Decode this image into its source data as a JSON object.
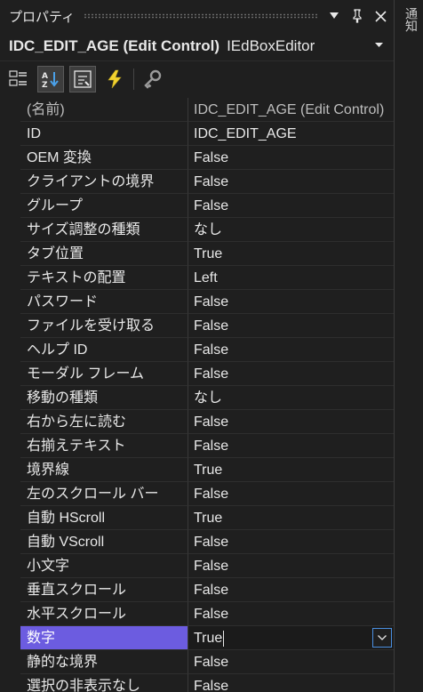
{
  "window": {
    "title": "プロパティ"
  },
  "title_buttons": {
    "dropdown": "▼",
    "pin": "📌",
    "close": "✕"
  },
  "selector": {
    "object_name": "IDC_EDIT_AGE (Edit Control)",
    "object_type": "IEdBoxEditor"
  },
  "toolbar": [
    "categorized-icon",
    "alphabetical-icon",
    "properties-icon",
    "events-icon",
    "property-pages-icon"
  ],
  "rows": [
    {
      "name": "(名前)",
      "value": "IDC_EDIT_AGE (Edit Control)"
    },
    {
      "name": "ID",
      "value": "IDC_EDIT_AGE"
    },
    {
      "name": "OEM 変換",
      "value": "False"
    },
    {
      "name": "クライアントの境界",
      "value": "False"
    },
    {
      "name": "グループ",
      "value": "False"
    },
    {
      "name": "サイズ調整の種類",
      "value": "なし"
    },
    {
      "name": "タブ位置",
      "value": "True"
    },
    {
      "name": "テキストの配置",
      "value": "Left"
    },
    {
      "name": "パスワード",
      "value": "False"
    },
    {
      "name": "ファイルを受け取る",
      "value": "False"
    },
    {
      "name": "ヘルプ ID",
      "value": "False"
    },
    {
      "name": "モーダル フレーム",
      "value": "False"
    },
    {
      "name": "移動の種類",
      "value": "なし"
    },
    {
      "name": "右から左に読む",
      "value": "False"
    },
    {
      "name": "右揃えテキスト",
      "value": "False"
    },
    {
      "name": "境界線",
      "value": "True"
    },
    {
      "name": "左のスクロール バー",
      "value": "False"
    },
    {
      "name": "自動 HScroll",
      "value": "True"
    },
    {
      "name": "自動 VScroll",
      "value": "False"
    },
    {
      "name": "小文字",
      "value": "False"
    },
    {
      "name": "垂直スクロール",
      "value": "False"
    },
    {
      "name": "水平スクロール",
      "value": "False"
    },
    {
      "name": "数字",
      "value": "True"
    },
    {
      "name": "静的な境界",
      "value": "False"
    },
    {
      "name": "選択の非表示なし",
      "value": "False"
    }
  ],
  "selected_row_index": 22,
  "side_panel": {
    "tab_label": "通知"
  },
  "colors": {
    "selection": "#6c5ce0",
    "background": "#1f1f1f",
    "focus_border": "#4a8fe0"
  }
}
